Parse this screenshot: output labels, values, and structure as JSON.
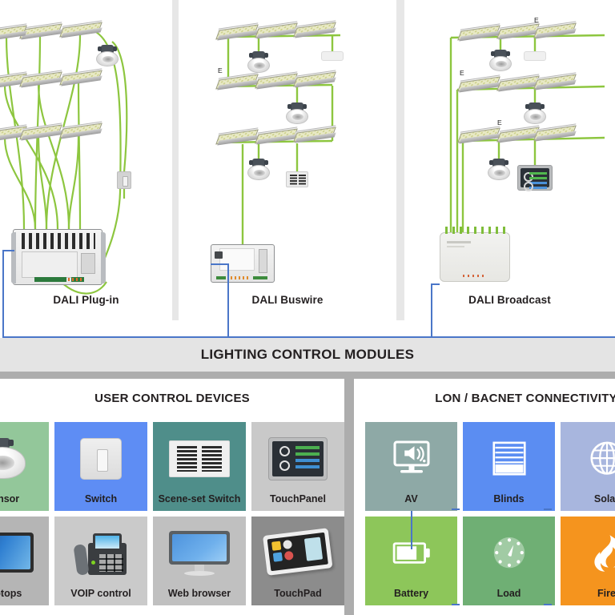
{
  "topology": {
    "panels": [
      {
        "caption": "DALI Plug-in",
        "controller": "dali-plugin-controller"
      },
      {
        "caption": "DALI  Buswire",
        "controller": "dali-buswire-controller"
      },
      {
        "caption": "DALI Broadcast",
        "controller": "dali-broadcast-controller"
      }
    ],
    "emergency_marker": "E"
  },
  "lighting_control_modules": {
    "title": "LIGHTING CONTROL MODULES"
  },
  "sections": [
    {
      "title": "USER CONTROL DEVICES",
      "tiles": [
        {
          "label": "Sensor",
          "icon": "ceiling-sensor-icon",
          "bg": "#93C79A"
        },
        {
          "label": "Switch",
          "icon": "wall-switch-icon",
          "bg": "#5E8DF4"
        },
        {
          "label": "Scene-set Switch",
          "icon": "scene-set-switch-icon",
          "bg": "#4F8E8A"
        },
        {
          "label": "TouchPanel",
          "icon": "touch-panel-icon",
          "bg": "#C9C9C9"
        },
        {
          "label": "Laptops",
          "icon": "laptop-icon",
          "bg": "#B5B5B5"
        },
        {
          "label": "VOIP control",
          "icon": "voip-phone-icon",
          "bg": "#CACACA"
        },
        {
          "label": "Web browser",
          "icon": "monitor-icon",
          "bg": "#C0C0C0"
        },
        {
          "label": "TouchPad",
          "icon": "touch-pad-icon",
          "bg": "#8C8C8C"
        }
      ]
    },
    {
      "title": "LON / BACNET CONNECTIVITY",
      "tiles": [
        {
          "label": "AV",
          "icon": "av-speaker-monitor-icon",
          "bg": "#8EA9A6"
        },
        {
          "label": "Blinds",
          "icon": "blinds-icon",
          "bg": "#5B8DF2"
        },
        {
          "label": "Solar",
          "icon": "globe-icon",
          "bg": "#A8B6DE"
        },
        {
          "label": "Battery",
          "icon": "battery-icon",
          "bg": "#8DC65A"
        },
        {
          "label": "Load",
          "icon": "gauge-icon",
          "bg": "#6FAF74"
        },
        {
          "label": "Fire",
          "icon": "flame-icon",
          "bg": "#F5941E"
        }
      ]
    }
  ],
  "colors": {
    "bus_blue": "#4A76C8",
    "dali_wire_green": "#8DC63F",
    "band_gray": "#E4E4E4",
    "divider_gray": "#ADADAD",
    "text_dark": "#231F20"
  }
}
